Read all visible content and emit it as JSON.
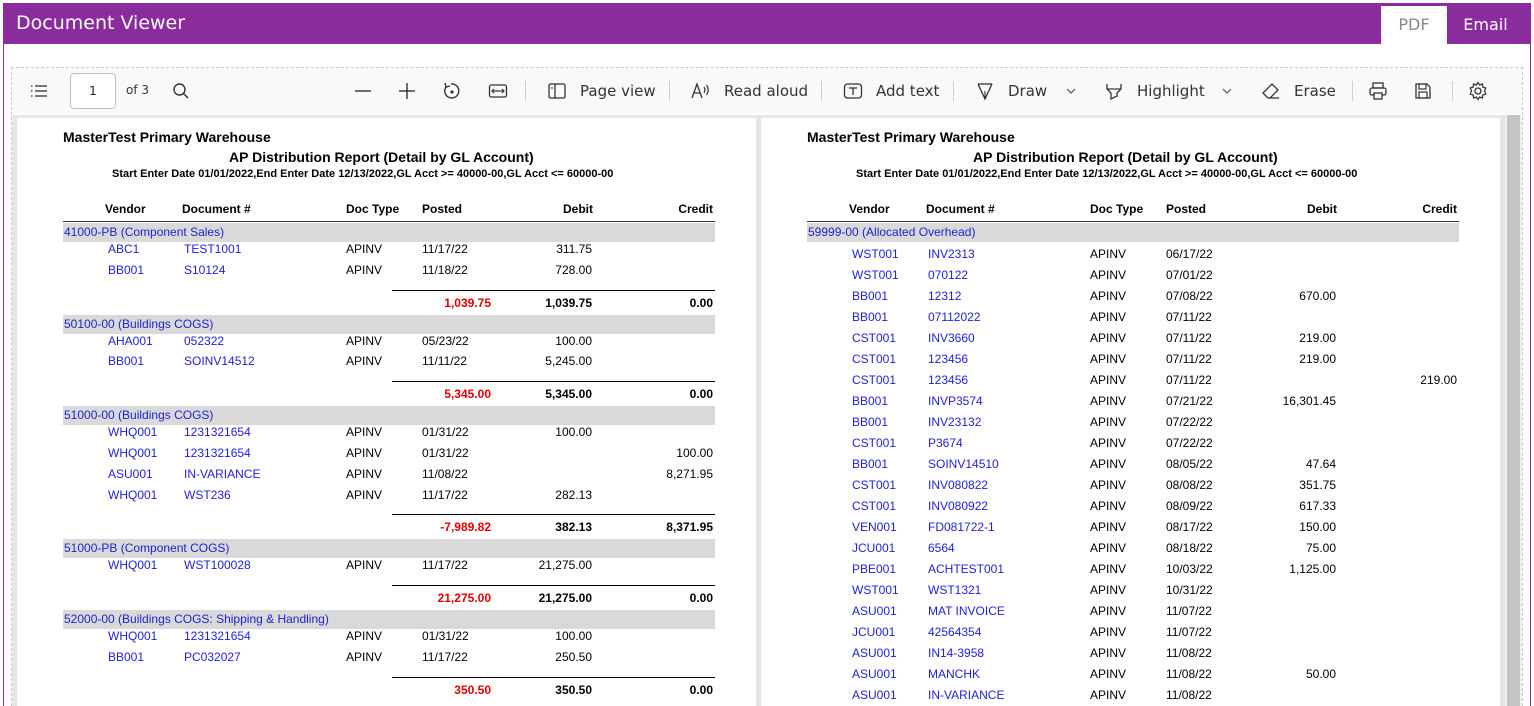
{
  "window": {
    "title": "Document Viewer",
    "tabs": [
      "PDF",
      "Email"
    ],
    "active_tab": "PDF"
  },
  "colors": {
    "titlebar": "#8a2c9c",
    "link": "#1f1fd1",
    "negative": "#e00000",
    "group_band": "#d9d9d9"
  },
  "toolbar": {
    "contents_icon": "list-icon",
    "page_number": "1",
    "page_count_label": "of 3",
    "search_icon": "search-icon",
    "page_view": "Page view",
    "read_aloud": "Read aloud",
    "add_text": "Add text",
    "draw": "Draw",
    "highlight": "Highlight",
    "erase": "Erase"
  },
  "report": {
    "company": "MasterTest Primary Warehouse",
    "title": "AP Distribution Report (Detail by GL Account)",
    "criteria": "Start Enter Date 01/01/2022,End Enter Date 12/13/2022,GL Acct >= 40000-00,GL Acct <= 60000-00",
    "columns": [
      "Vendor",
      "Document #",
      "Doc Type",
      "Posted",
      "Debit",
      "Credit"
    ]
  },
  "left_page": {
    "groups": [
      {
        "name": "41000-PB (Component Sales)",
        "rows": [
          [
            "ABC1",
            "TEST1001",
            "APINV",
            "11/17/22",
            "311.75",
            ""
          ],
          [
            "BB001",
            "S10124",
            "APINV",
            "11/18/22",
            "728.00",
            ""
          ]
        ],
        "total": {
          "net": "1,039.75",
          "debit": "1,039.75",
          "credit": "0.00"
        }
      },
      {
        "name": "50100-00 (Buildings COGS)",
        "rows": [
          [
            "AHA001",
            "052322",
            "APINV",
            "05/23/22",
            "100.00",
            ""
          ],
          [
            "BB001",
            "SOINV14512",
            "APINV",
            "11/11/22",
            "5,245.00",
            ""
          ]
        ],
        "total": {
          "net": "5,345.00",
          "debit": "5,345.00",
          "credit": "0.00"
        }
      },
      {
        "name": "51000-00 (Buildings COGS)",
        "rows": [
          [
            "WHQ001",
            "1231321654",
            "APINV",
            "01/31/22",
            "100.00",
            ""
          ],
          [
            "WHQ001",
            "1231321654",
            "APINV",
            "01/31/22",
            "",
            "100.00"
          ],
          [
            "ASU001",
            "IN-VARIANCE",
            "APINV",
            "11/08/22",
            "",
            "8,271.95"
          ],
          [
            "WHQ001",
            "WST236",
            "APINV",
            "11/17/22",
            "282.13",
            ""
          ]
        ],
        "total": {
          "net": "-7,989.82",
          "debit": "382.13",
          "credit": "8,371.95"
        }
      },
      {
        "name": "51000-PB (Component COGS)",
        "rows": [
          [
            "WHQ001",
            "WST100028",
            "APINV",
            "11/17/22",
            "21,275.00",
            ""
          ]
        ],
        "total": {
          "net": "21,275.00",
          "debit": "21,275.00",
          "credit": "0.00"
        }
      },
      {
        "name": "52000-00 (Buildings COGS: Shipping & Handling)",
        "rows": [
          [
            "WHQ001",
            "1231321654",
            "APINV",
            "01/31/22",
            "100.00",
            ""
          ],
          [
            "BB001",
            "PC032027",
            "APINV",
            "11/17/22",
            "250.50",
            ""
          ]
        ],
        "total": {
          "net": "350.50",
          "debit": "350.50",
          "credit": "0.00"
        }
      }
    ]
  },
  "right_page": {
    "groups": [
      {
        "name": "59999-00 (Allocated Overhead)",
        "rows": [
          [
            "WST001",
            "INV2313",
            "APINV",
            "06/17/22",
            "",
            ""
          ],
          [
            "WST001",
            "070122",
            "APINV",
            "07/01/22",
            "",
            ""
          ],
          [
            "BB001",
            "12312",
            "APINV",
            "07/08/22",
            "670.00",
            ""
          ],
          [
            "BB001",
            "07112022",
            "APINV",
            "07/11/22",
            "",
            ""
          ],
          [
            "CST001",
            "INV3660",
            "APINV",
            "07/11/22",
            "219.00",
            ""
          ],
          [
            "CST001",
            "123456",
            "APINV",
            "07/11/22",
            "219.00",
            ""
          ],
          [
            "CST001",
            "123456",
            "APINV",
            "07/11/22",
            "",
            "219.00"
          ],
          [
            "BB001",
            "INVP3574",
            "APINV",
            "07/21/22",
            "16,301.45",
            ""
          ],
          [
            "BB001",
            "INV23132",
            "APINV",
            "07/22/22",
            "",
            ""
          ],
          [
            "CST001",
            "P3674",
            "APINV",
            "07/22/22",
            "",
            ""
          ],
          [
            "BB001",
            "SOINV14510",
            "APINV",
            "08/05/22",
            "47.64",
            ""
          ],
          [
            "CST001",
            "INV080822",
            "APINV",
            "08/08/22",
            "351.75",
            ""
          ],
          [
            "CST001",
            "INV080922",
            "APINV",
            "08/09/22",
            "617.33",
            ""
          ],
          [
            "VEN001",
            "FD081722-1",
            "APINV",
            "08/17/22",
            "150.00",
            ""
          ],
          [
            "JCU001",
            "6564",
            "APINV",
            "08/18/22",
            "75.00",
            ""
          ],
          [
            "PBE001",
            "ACHTEST001",
            "APINV",
            "10/03/22",
            "1,125.00",
            ""
          ],
          [
            "WST001",
            "WST1321",
            "APINV",
            "10/31/22",
            "",
            ""
          ],
          [
            "ASU001",
            "MAT INVOICE",
            "APINV",
            "11/07/22",
            "",
            ""
          ],
          [
            "JCU001",
            "42564354",
            "APINV",
            "11/07/22",
            "",
            ""
          ],
          [
            "ASU001",
            "IN14-3958",
            "APINV",
            "11/08/22",
            "",
            ""
          ],
          [
            "ASU001",
            "MANCHK",
            "APINV",
            "11/08/22",
            "50.00",
            ""
          ],
          [
            "ASU001",
            "IN-VARIANCE",
            "APINV",
            "11/08/22",
            "",
            ""
          ]
        ]
      }
    ]
  }
}
